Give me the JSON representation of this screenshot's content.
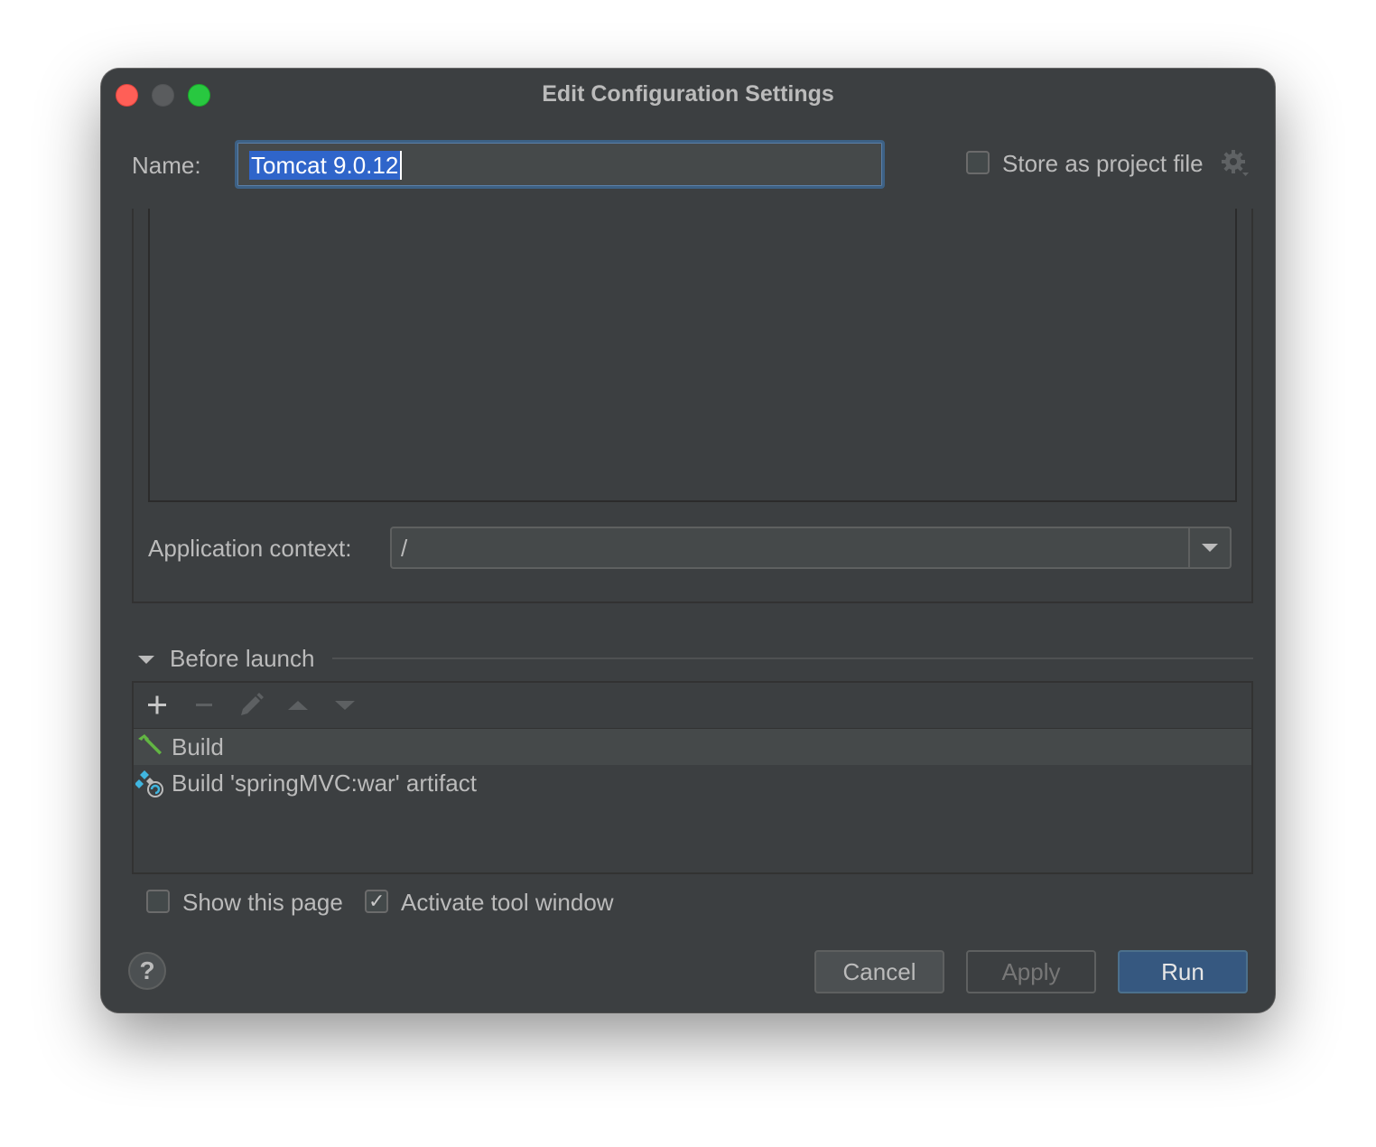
{
  "window": {
    "title": "Edit Configuration Settings"
  },
  "name_row": {
    "label": "Name:",
    "value": "Tomcat 9.0.12",
    "store_label": "Store as project file",
    "store_checked": false
  },
  "deployment": {
    "context_label": "Application context:",
    "context_value": "/"
  },
  "before_launch": {
    "label": "Before launch",
    "tasks": [
      {
        "label": "Build",
        "icon": "hammer-icon",
        "selected": true
      },
      {
        "label": "Build 'springMVC:war' artifact",
        "icon": "artifact-icon",
        "selected": false
      }
    ]
  },
  "options": {
    "show_page_label": "Show this page",
    "show_page_checked": false,
    "activate_label": "Activate tool window",
    "activate_checked": true
  },
  "buttons": {
    "help": "?",
    "cancel": "Cancel",
    "apply": "Apply",
    "run": "Run"
  },
  "colors": {
    "window_bg": "#3c3f41",
    "field_bg": "#45494a",
    "focus_border": "#3d6185",
    "selection": "#2f65ca",
    "primary_button": "#365880",
    "hammer": "#62b543"
  }
}
